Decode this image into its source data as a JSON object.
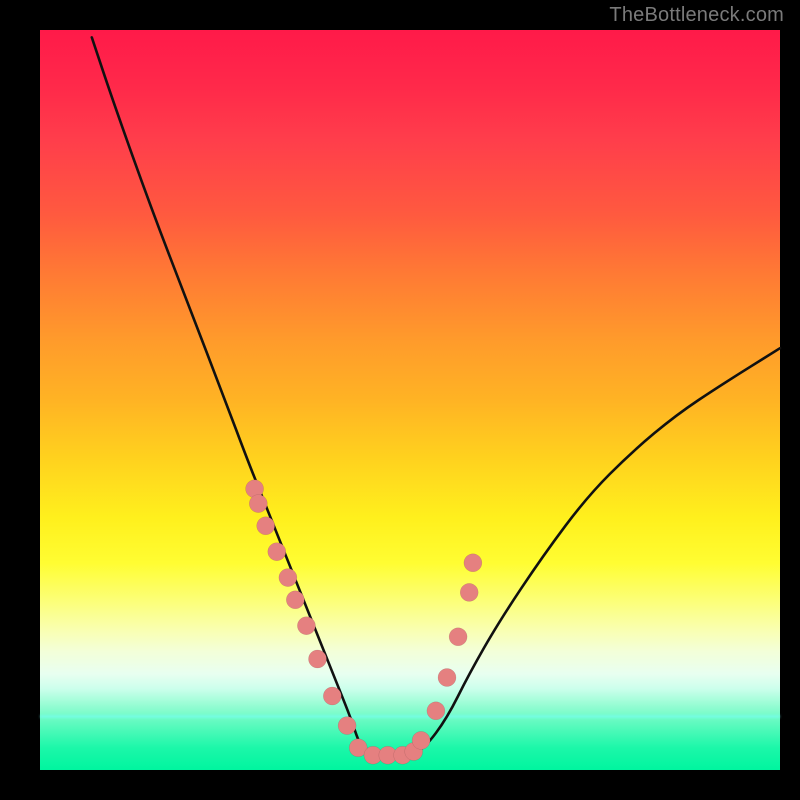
{
  "watermark": "TheBottleneck.com",
  "colors": {
    "dot": "#e58080",
    "curve": "#111111"
  },
  "chart_data": {
    "type": "line",
    "title": "",
    "xlabel": "",
    "ylabel": "",
    "xlim": [
      0,
      100
    ],
    "ylim": [
      0,
      100
    ],
    "grid": false,
    "legend": null,
    "curve": {
      "x": [
        7,
        10,
        15,
        20,
        25,
        28,
        30,
        32,
        34,
        36,
        38,
        40,
        42,
        43,
        44,
        46,
        48,
        50,
        52,
        55,
        58,
        62,
        68,
        74,
        80,
        86,
        92,
        100
      ],
      "y": [
        99,
        90,
        76,
        63,
        50,
        42,
        37,
        32,
        27,
        22,
        17,
        12,
        7,
        4,
        2,
        2,
        2,
        2,
        3,
        7,
        13,
        20,
        29,
        37,
        43,
        48,
        52,
        57
      ]
    },
    "dots": {
      "x": [
        29.0,
        29.5,
        30.5,
        32.0,
        33.5,
        34.5,
        36.0,
        37.5,
        39.5,
        41.5,
        43.0,
        45.0,
        47.0,
        49.0,
        50.5,
        51.5,
        53.5,
        55.0,
        56.5,
        58.0,
        58.5
      ],
      "y": [
        38.0,
        36.0,
        33.0,
        29.5,
        26.0,
        23.0,
        19.5,
        15.0,
        10.0,
        6.0,
        3.0,
        2.0,
        2.0,
        2.0,
        2.5,
        4.0,
        8.0,
        12.5,
        18.0,
        24.0,
        28.0
      ]
    }
  }
}
